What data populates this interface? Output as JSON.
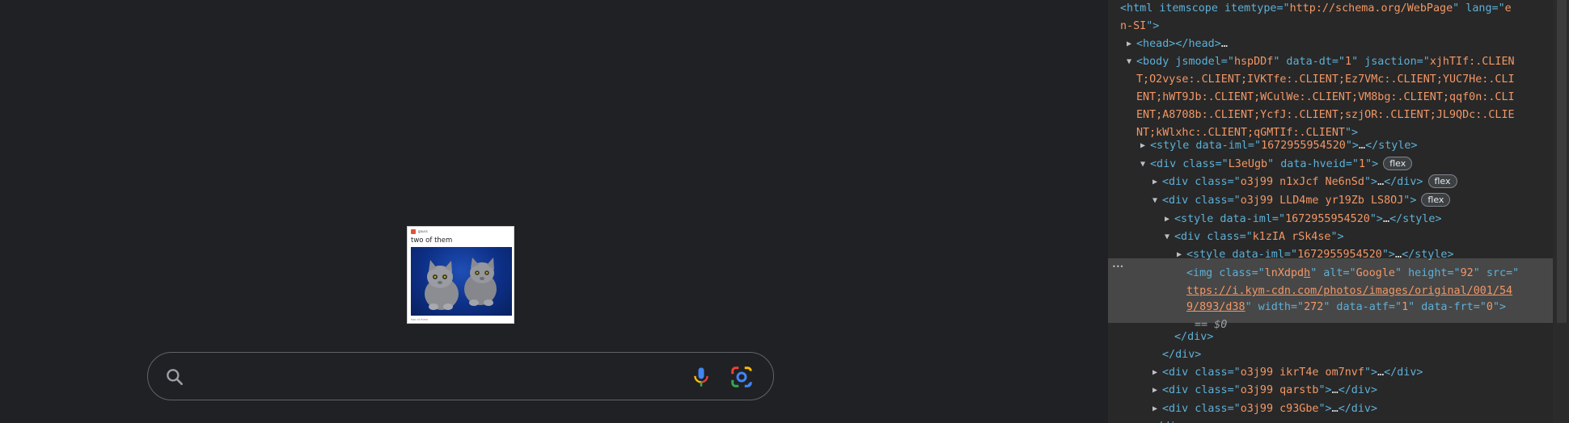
{
  "logo_card": {
    "username": "gauss",
    "caption": "two of them",
    "footer": "two of them"
  },
  "search": {
    "placeholder": "",
    "value": ""
  },
  "devtools": {
    "selected_marker": "== $0",
    "badge_flex": "flex",
    "lines": [
      {
        "p1": "<html itemscope itemtype=\"",
        "v1": "http://schema.org/WebPage",
        "p2": "\" lang=\"",
        "v2": "e"
      },
      {
        "v1": "n-SI",
        "p2": "\">"
      },
      {
        "p1": "<head>",
        "t": "…",
        "p2": "</head>"
      },
      {
        "p1": "<body jsmodel=\"",
        "v1": "hspDDf",
        "p2": "\" data-dt=\"",
        "v2": "1",
        "p3": "\" jsaction=\"",
        "v3": "xjhTIf:.CLIEN"
      },
      {
        "v1": "T;O2vyse:.CLIENT;IVKTfe:.CLIENT;Ez7VMc:.CLIENT;YUC7He:.CLI"
      },
      {
        "v1": "ENT;hWT9Jb:.CLIENT;WCulWe:.CLIENT;VM8bg:.CLIENT;qqf0n:.CLI"
      },
      {
        "v1": "ENT;A8708b:.CLIENT;YcfJ:.CLIENT;szjOR:.CLIENT;JL9QDc:.CLIE"
      },
      {
        "v1": "NT;kWlxhc:.CLIENT;qGMTIf:.CLIENT",
        "p2": "\">"
      },
      {
        "p1": "<style data-iml=\"",
        "v1": "1672955954520",
        "p2": "\">",
        "t": "…",
        "p3": "</style>"
      },
      {
        "p1": "<div class=\"",
        "v1": "L3eUgb",
        "p2": "\" data-hveid=\"",
        "v2": "1",
        "p3": "\">"
      },
      {
        "p1": "<div class=\"",
        "v1": "o3j99 n1xJcf Ne6nSd",
        "p2": "\">",
        "t": "…",
        "p3": "</div>"
      },
      {
        "p1": "<div class=\"",
        "v1": "o3j99 LLD4me yr19Zb LS8OJ",
        "p2": "\">"
      },
      {
        "p1": "<style data-iml=\"",
        "v1": "1672955954520",
        "p2": "\">",
        "t": "…",
        "p3": "</style>"
      },
      {
        "p1": "<div class=\"",
        "v1": "k1zIA rSk4se",
        "p2": "\">"
      },
      {
        "p1": "<style data-iml=\"",
        "v1": "1672955954520",
        "p2": "\">",
        "t": "…",
        "p3": "</style>"
      },
      {
        "p1": "<img class=\"",
        "v1": "lnXdpd",
        "p2": "\" alt=\"",
        "v2": "Google",
        "p3": "\" height=\"",
        "v3": "92",
        "p4": "\" src=\"",
        "l1": "h"
      },
      {
        "l1": "ttps://i.kym-cdn.com/photos/images/original/001/54"
      },
      {
        "l1": "9/893/d38",
        "p2": "\" width=\"",
        "v2": "272",
        "p3": "\" data-atf=\"",
        "v3": "1",
        "p4": "\" data-frt=\"",
        "v4": "0",
        "p5": "\">"
      },
      {
        "p1": "</div>"
      },
      {
        "p1": "</div>"
      },
      {
        "p1": "<div class=\"",
        "v1": "o3j99 ikrT4e om7nvf",
        "p2": "\">",
        "t": "…",
        "p3": "</div>"
      },
      {
        "p1": "<div class=\"",
        "v1": "o3j99 qarstb",
        "p2": "\">",
        "t": "…",
        "p3": "</div>"
      },
      {
        "p1": "<div class=\"",
        "v1": "o3j99 c93Gbe",
        "p2": "\">",
        "t": "…",
        "p3": "</div>"
      },
      {
        "p1": "</div>"
      }
    ]
  }
}
